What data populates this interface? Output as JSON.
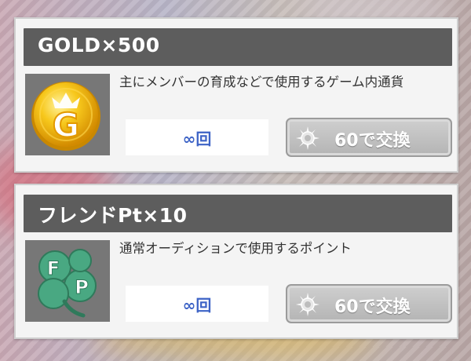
{
  "items": [
    {
      "title": "GOLD×500",
      "icon": "gold-coin-icon",
      "icon_letter": "G",
      "description": "主にメンバーの育成などで使用するゲーム内通貨",
      "count": "∞回",
      "button_label": "60で交換",
      "button_icon": "crystal-medal-icon"
    },
    {
      "title": "フレンドPt×10",
      "icon": "friend-point-clover-icon",
      "icon_letters": [
        "F",
        "P"
      ],
      "description": "通常オーディションで使用するポイント",
      "count": "∞回",
      "button_label": "60で交換",
      "button_icon": "crystal-medal-icon"
    }
  ],
  "colors": {
    "header_bg": "#5d5d5d",
    "count_text": "#3d63c6",
    "gold": "#f2b705",
    "clover": "#3e9a74"
  }
}
